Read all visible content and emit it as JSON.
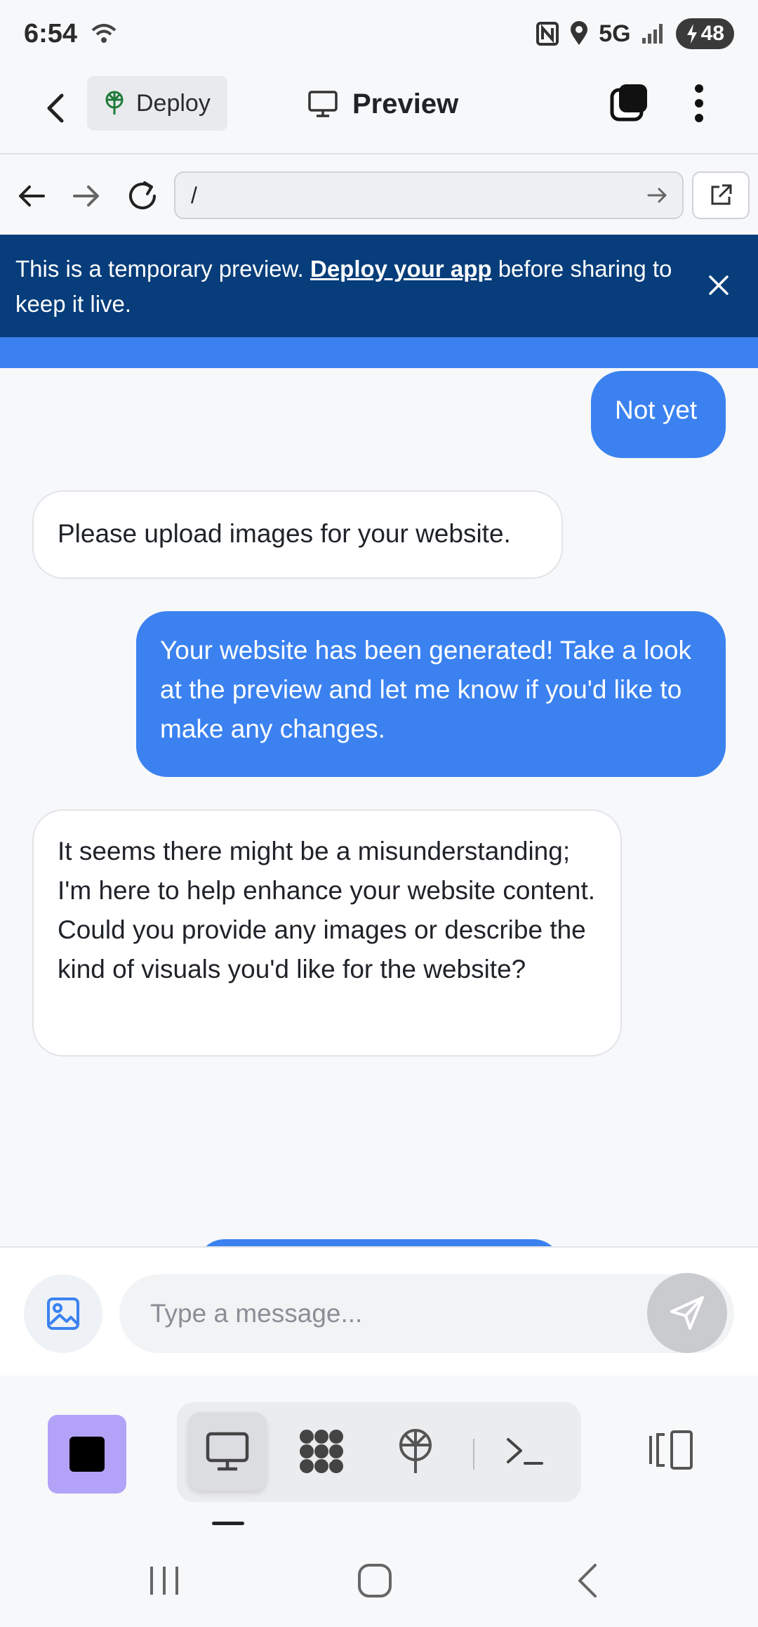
{
  "status_bar": {
    "time": "6:54",
    "network": "5G",
    "battery": "48"
  },
  "app_bar": {
    "deploy_label": "Deploy",
    "title": "Preview"
  },
  "url_bar": {
    "value": "/"
  },
  "banner": {
    "text_before": "This is a temporary preview. ",
    "link": "Deploy your app",
    "text_after": " before sharing to keep it live."
  },
  "messages": [
    {
      "role": "user",
      "text": "Not yet"
    },
    {
      "role": "assistant",
      "text": "Please upload images for your website."
    },
    {
      "role": "user",
      "text": "Your website has been generated! Take a look at the preview and let me know if you'd like to make any changes."
    },
    {
      "role": "assistant",
      "text": "It seems there might be a misunderstanding; I'm here to help enhance your website content. Could you provide any images or describe the kind of visuals you'd like for the website?"
    }
  ],
  "composer": {
    "placeholder": "Type a message..."
  },
  "colors": {
    "accent": "#3b82f0",
    "banner": "#063d7a",
    "stop_button": "#b3a3f8"
  }
}
